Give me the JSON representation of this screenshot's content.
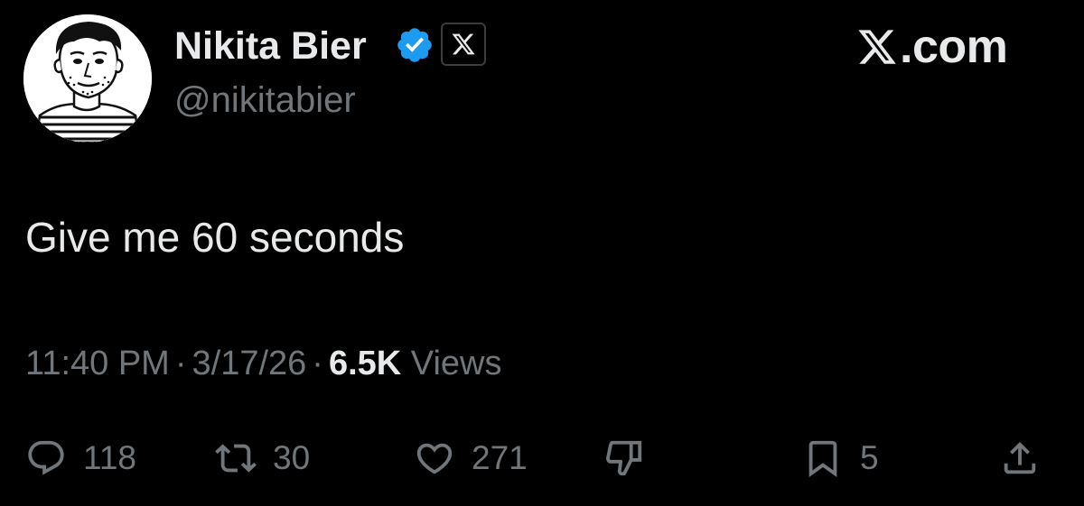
{
  "author": {
    "name": "Nikita Bier",
    "handle": "@nikitabier",
    "verified_color": "#1d9bf0"
  },
  "brand": {
    "site": ".com"
  },
  "tweet": {
    "text": "Give me 60 seconds"
  },
  "meta": {
    "time": "11:40 PM",
    "separator": "·",
    "date": "3/17/26",
    "views_count": "6.5K",
    "views_label": "Views"
  },
  "actions": {
    "replies": "118",
    "reposts": "30",
    "likes": "271",
    "bookmarks": "5"
  },
  "icons": [
    "avatar",
    "verified-badge-icon",
    "x-logo-icon",
    "reply-icon",
    "repost-icon",
    "like-icon",
    "dislike-icon",
    "bookmark-icon",
    "share-icon"
  ]
}
